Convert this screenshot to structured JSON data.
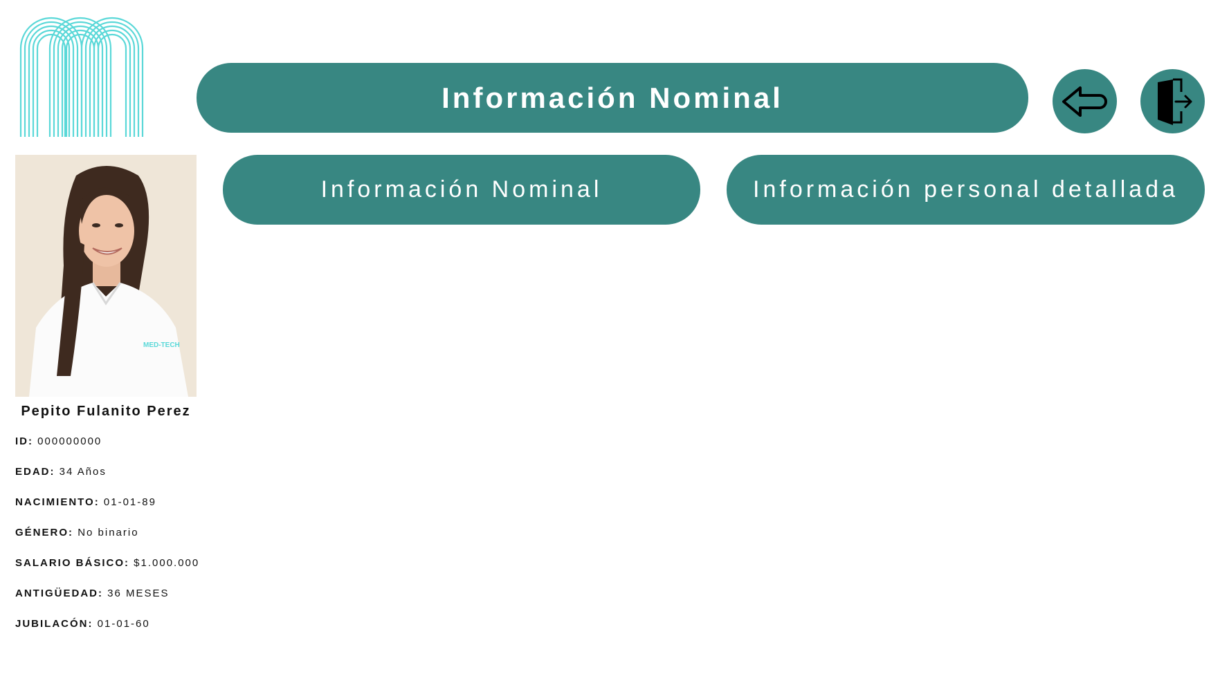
{
  "header": {
    "title": "Información Nominal",
    "back_icon": "arrow-left-icon",
    "exit_icon": "exit-door-icon"
  },
  "tabs": [
    {
      "label": "Información Nominal"
    },
    {
      "label": "Información personal detallada"
    }
  ],
  "employee": {
    "name": "Pepito Fulanito Perez",
    "fields": [
      {
        "label": "ID:",
        "value": "000000000"
      },
      {
        "label": "EDAD:",
        "value": "34 Años"
      },
      {
        "label": "NACIMIENTO:",
        "value": "01-01-89"
      },
      {
        "label": "GÉNERO:",
        "value": "No binario"
      },
      {
        "label": "SALARIO BÁSICO:",
        "value": "$1.000.000"
      },
      {
        "label": "ANTIGÜEDAD:",
        "value": "36 MESES"
      },
      {
        "label": "JUBILACÓN:",
        "value": "01-01-60"
      }
    ]
  },
  "colors": {
    "accent": "#388782",
    "logo": "#5ad8d8",
    "text": "#111111"
  }
}
